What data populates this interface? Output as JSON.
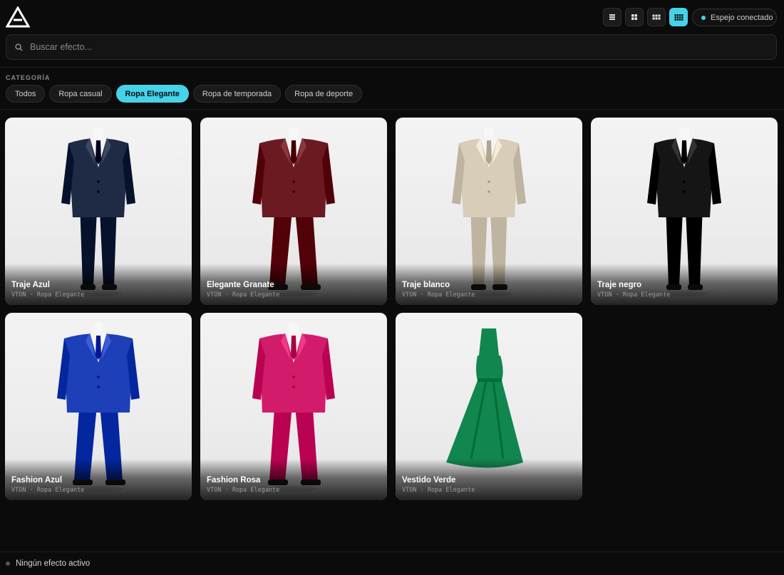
{
  "header": {
    "logo_icon": "triangle-logo-icon",
    "view_modes": [
      {
        "icon": "list-view-icon",
        "active": false
      },
      {
        "icon": "grid-2-icon",
        "active": false
      },
      {
        "icon": "grid-3-icon",
        "active": false
      },
      {
        "icon": "grid-4-icon",
        "active": true
      }
    ],
    "status": {
      "label": "Espejo conectado",
      "color": "#45d3ea"
    }
  },
  "search": {
    "placeholder": "Buscar efecto...",
    "value": "",
    "icon": "search-icon"
  },
  "categories": {
    "label": "CATEGORÍA",
    "items": [
      {
        "label": "Todos",
        "active": false
      },
      {
        "label": "Ropa casual",
        "active": false
      },
      {
        "label": "Ropa Elegante",
        "active": true
      },
      {
        "label": "Ropa de temporada",
        "active": false
      },
      {
        "label": "Ropa de deporte",
        "active": false
      }
    ]
  },
  "effects": [
    {
      "title": "Traje Azul",
      "meta": "VTON · Ropa Elegante",
      "figure": "suit",
      "color": "#1f2a44"
    },
    {
      "title": "Elegante Granate",
      "meta": "VTON · Ropa Elegante",
      "figure": "suit-wide",
      "color": "#6b1a22"
    },
    {
      "title": "Traje blanco",
      "meta": "VTON · Ropa Elegante",
      "figure": "suit",
      "color": "#d8cdb8"
    },
    {
      "title": "Traje negro",
      "meta": "VTON · Ropa Elegante",
      "figure": "suit",
      "color": "#151515"
    },
    {
      "title": "Fashion Azul",
      "meta": "VTON · Ropa Elegante",
      "figure": "suit-wide",
      "color": "#1d3fb8"
    },
    {
      "title": "Fashion Rosa",
      "meta": "VTON · Ropa Elegante",
      "figure": "suit-wide",
      "color": "#d21b6b"
    },
    {
      "title": "Vestido Verde",
      "meta": "VTON · Ropa Elegante",
      "figure": "dress",
      "color": "#11864f"
    }
  ],
  "footer": {
    "status": "Ningún efecto activo"
  },
  "colors": {
    "accent": "#45d3ea",
    "background": "#0b0b0b"
  }
}
